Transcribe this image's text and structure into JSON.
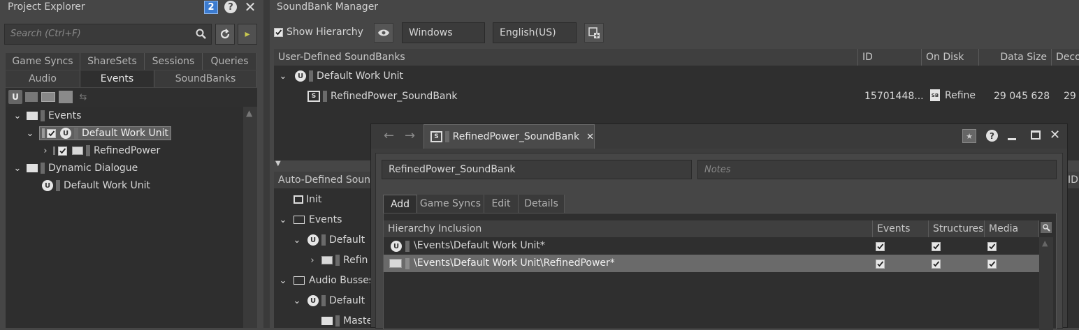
{
  "project_explorer": {
    "title": "Project Explorer",
    "badge": "2",
    "search_placeholder": "Search (Ctrl+F)",
    "tabs_row1": [
      "Game Syncs",
      "ShareSets",
      "Sessions",
      "Queries"
    ],
    "tabs_row2": [
      "Audio",
      "Events",
      "SoundBanks"
    ],
    "tree": [
      {
        "label": "Events"
      },
      {
        "label": "Default Work Unit"
      },
      {
        "label": "RefinedPower"
      },
      {
        "label": "Dynamic Dialogue"
      },
      {
        "label": "Default Work Unit"
      }
    ]
  },
  "soundbank_manager": {
    "title": "SoundBank Manager",
    "show_hierarchy": "Show Hierarchy",
    "platform": "Windows",
    "language": "English(US)",
    "user_defined": {
      "headers": [
        "User-Defined SoundBanks",
        "ID",
        "On Disk",
        "Data Size",
        "Deco"
      ],
      "rows": [
        {
          "label": "Default Work Unit"
        },
        {
          "label": "RefinedPower_SoundBank",
          "id": "15701448...",
          "on_disk": "Refine",
          "data_size": "29 045 628",
          "deco": "29"
        }
      ]
    },
    "auto_defined": {
      "header": "Auto-Defined Sounc",
      "id_header": "ID",
      "rows": [
        "Init",
        "Events",
        "Default",
        "Refin",
        "Audio Busses",
        "Default",
        "Maste"
      ]
    }
  },
  "editor": {
    "tab_title": "RefinedPower_SoundBank",
    "name_value": "RefinedPower_SoundBank",
    "notes_placeholder": "Notes",
    "tabs": [
      "Add",
      "Game Syncs",
      "Edit",
      "Details"
    ],
    "table": {
      "headers": [
        "Hierarchy Inclusion",
        "Events",
        "Structures",
        "Media"
      ],
      "rows": [
        {
          "path": "\\Events\\Default Work Unit*"
        },
        {
          "path": "\\Events\\Default Work Unit\\RefinedPower*"
        }
      ]
    }
  }
}
